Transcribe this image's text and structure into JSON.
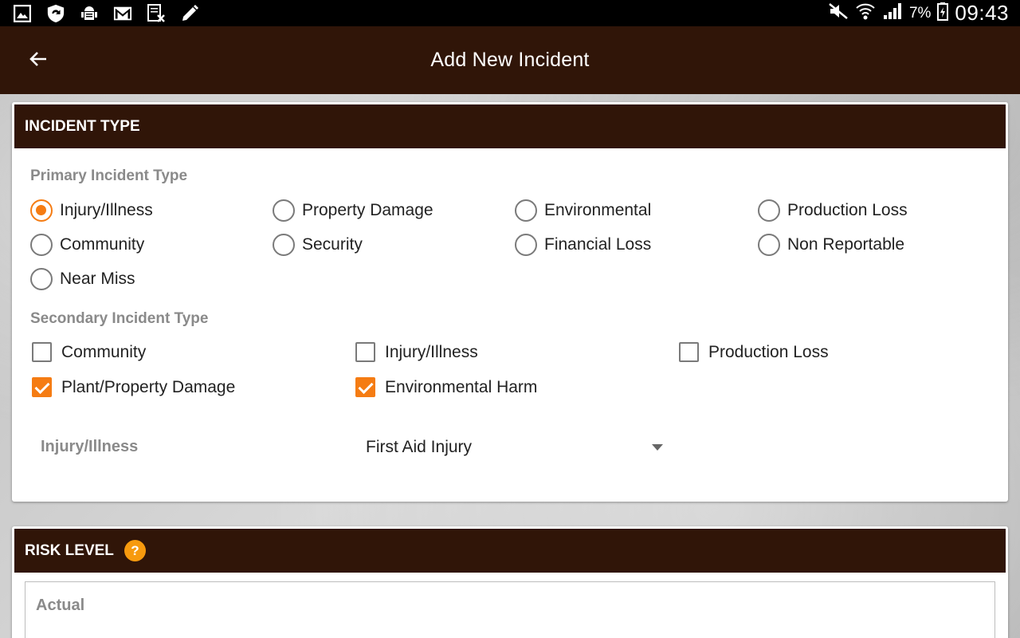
{
  "status_bar": {
    "battery": "7%",
    "time": "09:43",
    "left_icons": [
      "gallery-icon",
      "shield-sync-icon",
      "android-debug-icon",
      "gmail-icon",
      "document-x-icon",
      "pencil-icon"
    ],
    "right_icons": [
      "mute-icon",
      "wifi-icon",
      "signal-icon",
      "battery-icon"
    ]
  },
  "app_bar": {
    "title": "Add New Incident",
    "back_icon": "arrow-left-icon"
  },
  "incident_type": {
    "header": "INCIDENT TYPE",
    "primary_label": "Primary Incident Type",
    "primary_options": [
      {
        "label": "Injury/Illness",
        "checked": true
      },
      {
        "label": "Property Damage",
        "checked": false
      },
      {
        "label": "Environmental",
        "checked": false
      },
      {
        "label": "Production Loss",
        "checked": false
      },
      {
        "label": "Community",
        "checked": false
      },
      {
        "label": "Security",
        "checked": false
      },
      {
        "label": "Financial Loss",
        "checked": false
      },
      {
        "label": "Non Reportable",
        "checked": false
      },
      {
        "label": "Near Miss",
        "checked": false
      }
    ],
    "secondary_label": "Secondary Incident Type",
    "secondary_options": [
      {
        "label": "Community",
        "checked": false
      },
      {
        "label": "Injury/Illness",
        "checked": false
      },
      {
        "label": "Production Loss",
        "checked": false
      },
      {
        "label": "Plant/Property Damage",
        "checked": true
      },
      {
        "label": "Environmental Harm",
        "checked": true
      }
    ],
    "dropdown": {
      "label": "Injury/Illness",
      "value": "First Aid Injury"
    }
  },
  "risk_level": {
    "header": "RISK LEVEL",
    "help": "?",
    "actual_label": "Actual"
  },
  "colors": {
    "brand_dark": "#301508",
    "accent": "#f57c13",
    "help_badge": "#f79a0e"
  }
}
